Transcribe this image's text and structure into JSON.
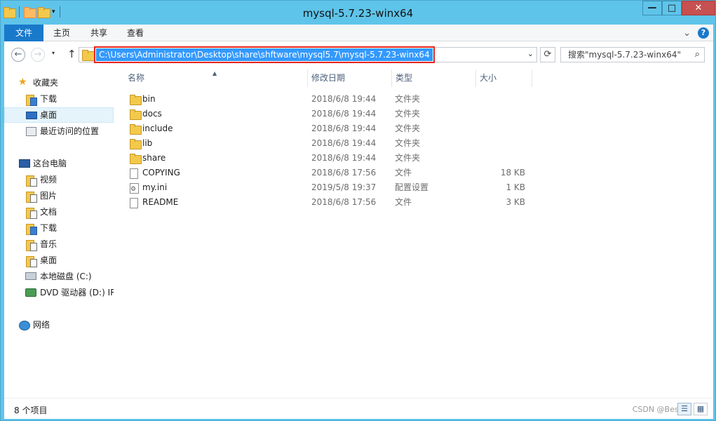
{
  "window": {
    "title": "mysql-5.7.23-winx64",
    "controls": {
      "minimize": "—",
      "maximize": "□",
      "close": "✕"
    }
  },
  "ribbon": {
    "tabs": [
      "文件",
      "主页",
      "共享",
      "查看"
    ],
    "expand_glyph": "⌄",
    "help_glyph": "?"
  },
  "address": {
    "path": "C:\\Users\\Administrator\\Desktop\\share\\shftware\\mysql5.7\\mysql-5.7.23-winx64",
    "dropdown_glyph": "⌄",
    "refresh_glyph": "⟳",
    "back_glyph": "←",
    "forward_glyph": "→",
    "up_glyph": "↑",
    "recent_glyph": "▾"
  },
  "search": {
    "placeholder": "搜索\"mysql-5.7.23-winx64\"",
    "icon_glyph": "⌕"
  },
  "sidebar": {
    "favorites_label": "收藏夹",
    "favorites": [
      "下载",
      "桌面",
      "最近访问的位置"
    ],
    "pc_label": "这台电脑",
    "pc_items": [
      "视频",
      "图片",
      "文档",
      "下载",
      "音乐",
      "桌面",
      "本地磁盘 (C:)",
      "DVD 驱动器 (D:) IR"
    ],
    "network_label": "网络"
  },
  "columns": {
    "name": "名称",
    "date": "修改日期",
    "type": "类型",
    "size": "大小",
    "sort_glyph": "▲"
  },
  "files": [
    {
      "name": "bin",
      "date": "2018/6/8 19:44",
      "type": "文件夹",
      "size": "",
      "icon": "folder-icon"
    },
    {
      "name": "docs",
      "date": "2018/6/8 19:44",
      "type": "文件夹",
      "size": "",
      "icon": "folder-icon"
    },
    {
      "name": "include",
      "date": "2018/6/8 19:44",
      "type": "文件夹",
      "size": "",
      "icon": "folder-icon"
    },
    {
      "name": "lib",
      "date": "2018/6/8 19:44",
      "type": "文件夹",
      "size": "",
      "icon": "folder-icon"
    },
    {
      "name": "share",
      "date": "2018/6/8 19:44",
      "type": "文件夹",
      "size": "",
      "icon": "folder-icon"
    },
    {
      "name": "COPYING",
      "date": "2018/6/8 17:56",
      "type": "文件",
      "size": "18 KB",
      "icon": "file-icon"
    },
    {
      "name": "my.ini",
      "date": "2019/5/8 19:37",
      "type": "配置设置",
      "size": "1 KB",
      "icon": "ini-file-icon"
    },
    {
      "name": "README",
      "date": "2018/6/8 17:56",
      "type": "文件",
      "size": "3 KB",
      "icon": "file-icon"
    }
  ],
  "status": {
    "item_count": "8 个项目",
    "watermark": "CSDN @Bestte",
    "details_glyph": "☰",
    "icons_glyph": "▦"
  },
  "colors": {
    "frame": "#5fc4ea",
    "file_tab": "#1979ca",
    "selection": "#3399ff",
    "highlight_box": "#e8231b",
    "close_button": "#c75050"
  }
}
